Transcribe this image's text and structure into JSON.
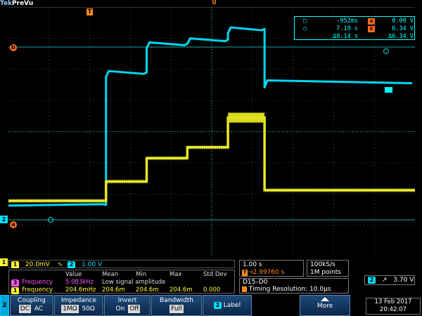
{
  "header": {
    "brand": "Tek",
    "mode": "PreVu"
  },
  "markers": {
    "trigger_pos": "T",
    "expand": "U",
    "ref_a": "a",
    "ref_b": "b",
    "ch2_ground": "2"
  },
  "cursor_readout": {
    "row1": {
      "symbol": "□",
      "time": "-952ms",
      "tag": "a",
      "value": "0.00 V"
    },
    "row2": {
      "symbol": "○",
      "time": "7.19 s",
      "tag": "b",
      "value": "6.34 V"
    },
    "row3": {
      "time": "Δ8.14 s",
      "value": "Δ6.34 V"
    }
  },
  "channels": {
    "ch1": {
      "num": "1",
      "scale": "20.0mV",
      "color": "#ffff33"
    },
    "ch2": {
      "num": "2",
      "scale": "1.00 V",
      "color": "#00e0ff"
    },
    "bw_icon": "∿"
  },
  "measurements": {
    "headers": [
      "Value",
      "Mean",
      "Min",
      "Max",
      "Std Dev"
    ],
    "rows": [
      {
        "badge": "3",
        "name": "Frequency",
        "value": "5.083kHz",
        "note": "Low signal amplitude",
        "color": "#ff55ff"
      },
      {
        "badge": "1",
        "name": "Frequency",
        "value": "204.6mHz",
        "mean": "204.6m",
        "min": "204.6m",
        "max": "204.6m",
        "std": "0.000",
        "color": "#ffff33"
      }
    ]
  },
  "timebase": {
    "scale": "1.00 s",
    "trigger_delay": "2.99760 s"
  },
  "acquisition": {
    "rate": "100kS/s",
    "points": "1M points"
  },
  "digital": {
    "title": "D15–D0",
    "timing": "Timing Resolution: 10.0μs"
  },
  "trigger": {
    "source": "2",
    "slope": "↗",
    "level": "3.70 V"
  },
  "menu": {
    "channel": "2",
    "coupling": {
      "label": "Coupling",
      "options": [
        "DC",
        "AC"
      ],
      "selected": "DC"
    },
    "impedance": {
      "label": "Impedance",
      "options": [
        "1MΩ",
        "50Ω"
      ],
      "selected": "1MΩ"
    },
    "invert": {
      "label": "Invert",
      "options": [
        "On",
        "Off"
      ],
      "selected": "Off"
    },
    "bandwidth": {
      "label": "Bandwidth",
      "value": "Full"
    },
    "label_btn": {
      "badge": "2",
      "label": "Label"
    },
    "more": "More"
  },
  "datetime": {
    "date": "13 Feb 2017",
    "time": "20:42:07"
  },
  "waveforms": {
    "ch2_levels": [
      -2.35,
      1.9,
      2.82,
      2.95,
      3.3,
      1.6
    ],
    "ch1_levels": [
      -2.22,
      -1.6,
      -0.85,
      -0.5,
      0.45,
      -1.88
    ],
    "step_divs": [
      0,
      2.4,
      3.4,
      4.4,
      5.4,
      6.3,
      10
    ]
  }
}
